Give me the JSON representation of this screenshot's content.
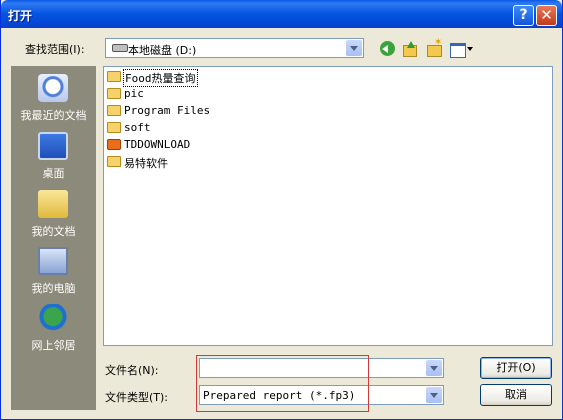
{
  "window": {
    "title": "打开"
  },
  "titlebar": {
    "help": "?",
    "close": "✕"
  },
  "toolbar": {
    "lookin_label": "查找范围(I):",
    "lookin_value": "本地磁盘 (D:)",
    "icons": [
      "back-icon",
      "up-folder-icon",
      "new-folder-icon",
      "views-menu-icon"
    ]
  },
  "places": [
    {
      "label": "我最近的文档",
      "icon": "recent-documents-icon"
    },
    {
      "label": "桌面",
      "icon": "desktop-icon"
    },
    {
      "label": "我的文档",
      "icon": "my-documents-icon"
    },
    {
      "label": "我的电脑",
      "icon": "my-computer-icon"
    },
    {
      "label": "网上邻居",
      "icon": "network-places-icon"
    }
  ],
  "files": [
    {
      "name": "Food热量查询",
      "type": "folder"
    },
    {
      "name": "pic",
      "type": "folder"
    },
    {
      "name": "Program Files",
      "type": "folder"
    },
    {
      "name": "soft",
      "type": "folder"
    },
    {
      "name": "TDDOWNLOAD",
      "type": "special-folder"
    },
    {
      "name": "易特软件",
      "type": "folder"
    }
  ],
  "form": {
    "filename_label": "文件名(N):",
    "filename_value": "",
    "filetype_label": "文件类型(T):",
    "filetype_value": "Prepared report (*.fp3)"
  },
  "buttons": {
    "open": "打开(O)",
    "cancel": "取消"
  },
  "colors": {
    "title_bar": "#0454e0",
    "dialog_bg": "#ece9d8",
    "places_bar": "#8c8a7a",
    "highlight_box": "#d23a3a"
  }
}
